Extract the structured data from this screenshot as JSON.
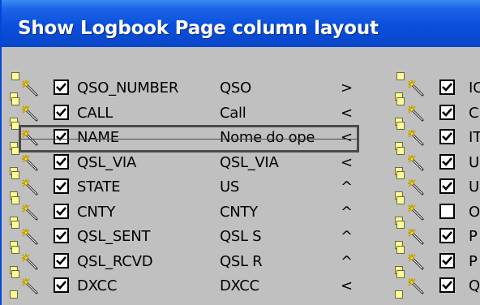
{
  "window": {
    "title": "Show Logbook Page column layout"
  },
  "colors": {
    "title_bar": "#0a4fdc",
    "client": "#c0c0c0",
    "handle": "#ffff99"
  },
  "icons": {
    "drag": "magic-wand-icon",
    "check": "checkmark-icon"
  },
  "left_column": [
    {
      "field": "QSO_NUMBER",
      "label": "QSO",
      "align": ">",
      "checked": true
    },
    {
      "field": "CALL",
      "label": "Call",
      "align": "<",
      "checked": true
    },
    {
      "field": "NAME",
      "label": "Nome do ope",
      "align": "<",
      "checked": true
    },
    {
      "field": "QSL_VIA",
      "label": "QSL_VIA",
      "align": "<",
      "checked": true
    },
    {
      "field": "STATE",
      "label": "US",
      "align": "^",
      "checked": true
    },
    {
      "field": "CNTY",
      "label": "CNTY",
      "align": "^",
      "checked": true
    },
    {
      "field": "QSL_SENT",
      "label": "QSL S",
      "align": "^",
      "checked": true
    },
    {
      "field": "QSL_RCVD",
      "label": "QSL R",
      "align": "^",
      "checked": true
    },
    {
      "field": "DXCC",
      "label": "DXCC",
      "align": "<",
      "checked": true
    }
  ],
  "right_column": [
    {
      "text": "IC",
      "checked": true
    },
    {
      "text": "C",
      "checked": true
    },
    {
      "text": "IT",
      "checked": true
    },
    {
      "text": "U",
      "checked": true
    },
    {
      "text": "U",
      "checked": true
    },
    {
      "text": "O",
      "checked": false
    },
    {
      "text": "P",
      "checked": true
    },
    {
      "text": "P",
      "checked": true
    },
    {
      "text": "Q",
      "checked": true
    }
  ]
}
